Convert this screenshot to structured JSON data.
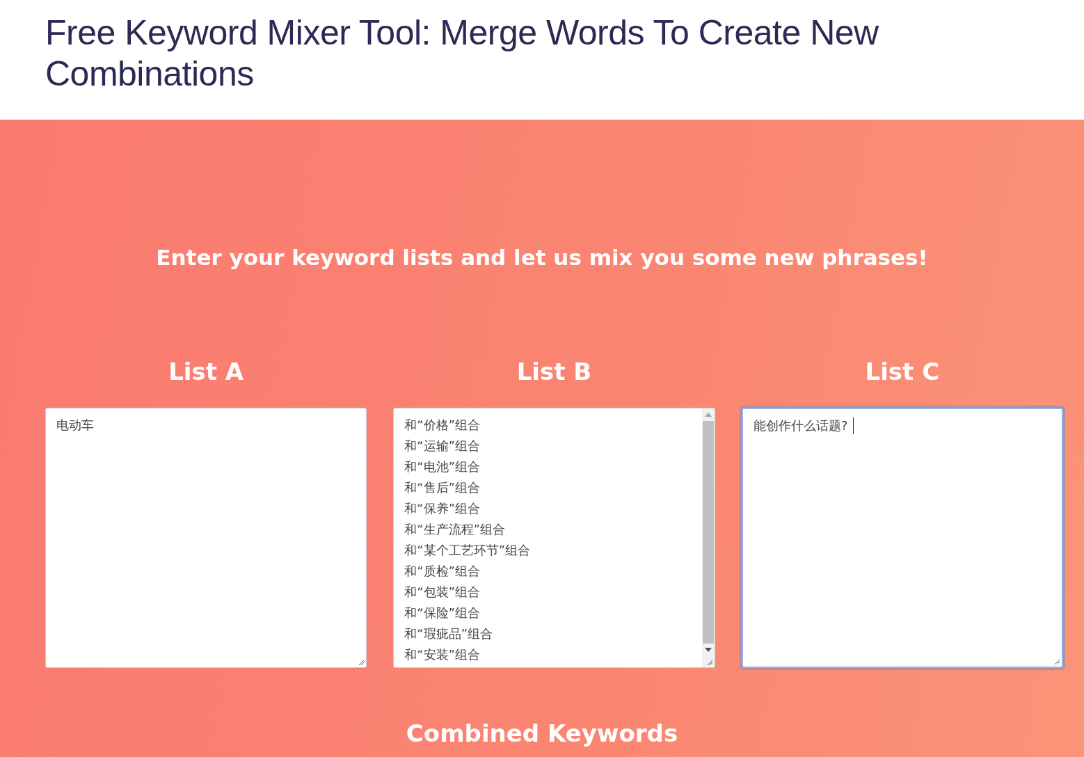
{
  "page_title": "Free Keyword Mixer Tool: Merge Words To Create New Combinations",
  "hero": {
    "headline": "Enter your keyword lists and let us mix you some new phrases!",
    "lists": [
      {
        "heading": "List A",
        "focused": false,
        "scrollable": false,
        "lines": [
          "电动车"
        ]
      },
      {
        "heading": "List B",
        "focused": false,
        "scrollable": true,
        "lines": [
          "和“价格”组合",
          "和“运输”组合",
          "和“电池”组合",
          "和“售后”组合",
          "和“保养”组合",
          "和“生产流程”组合",
          "和“某个工艺环节”组合",
          "和“质检”组合",
          "和“包装”组合",
          "和“保险”组合",
          "和“瑕疵品”组合",
          "和“安装”组合"
        ]
      },
      {
        "heading": "List C",
        "focused": true,
        "scrollable": false,
        "lines": [
          "能创作什么话题?"
        ]
      }
    ],
    "output_heading": "Combined Keywords"
  }
}
